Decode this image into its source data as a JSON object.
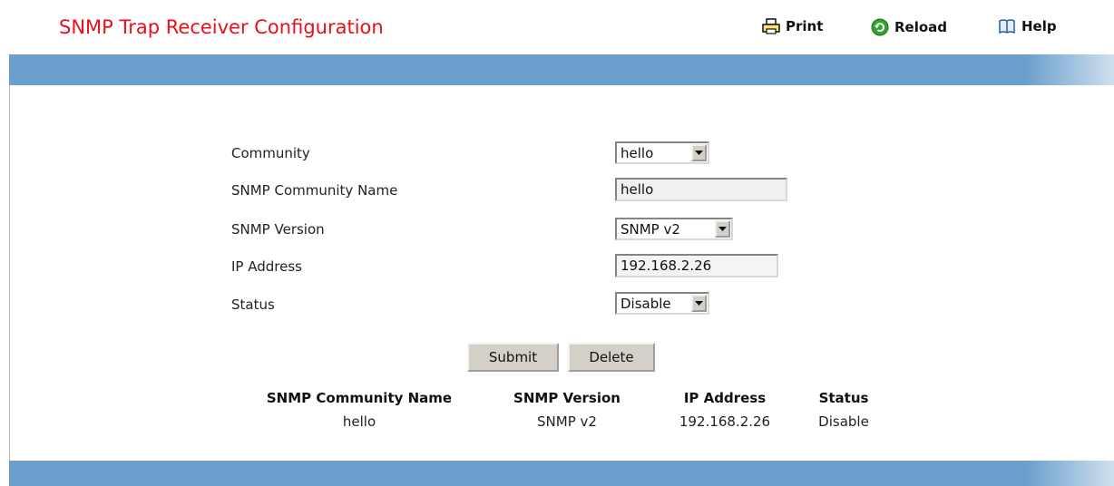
{
  "page": {
    "title": "SNMP Trap Receiver Configuration"
  },
  "toolbar": {
    "print": "Print",
    "reload": "Reload",
    "help": "Help"
  },
  "form": {
    "community": {
      "label": "Community",
      "value": "hello"
    },
    "community_name": {
      "label": "SNMP Community Name",
      "value": "hello"
    },
    "version": {
      "label": "SNMP Version",
      "value": "SNMP v2"
    },
    "ip_address": {
      "label": "IP Address",
      "value": "192.168.2.26"
    },
    "status": {
      "label": "Status",
      "value": "Disable"
    }
  },
  "buttons": {
    "submit": "Submit",
    "delete": "Delete"
  },
  "table": {
    "headers": [
      "SNMP Community Name",
      "SNMP Version",
      "IP Address",
      "Status"
    ],
    "rows": [
      [
        "hello",
        "SNMP v2",
        "192.168.2.26",
        "Disable"
      ]
    ]
  },
  "colors": {
    "title": "#e8101a",
    "band": "#6b9fcc"
  }
}
